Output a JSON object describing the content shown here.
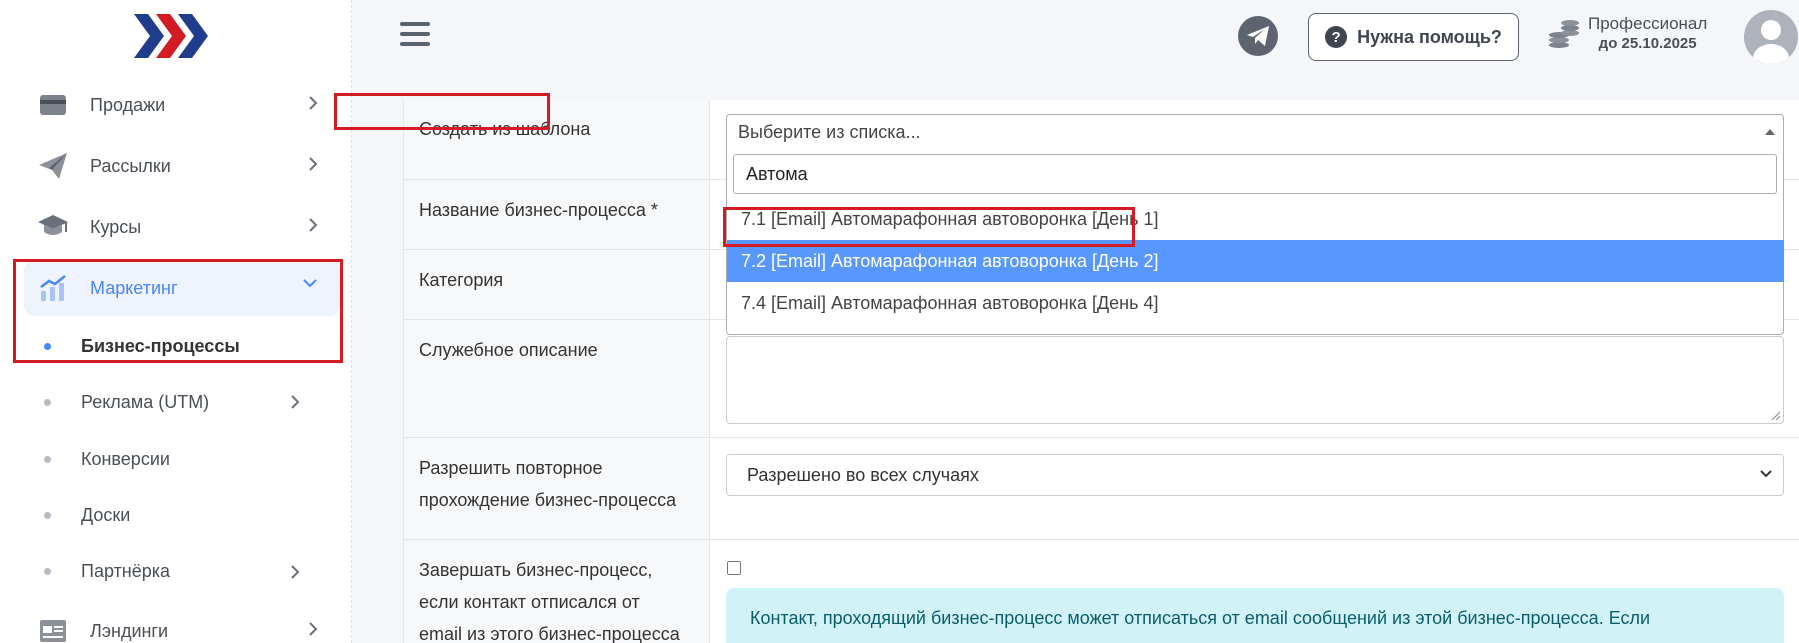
{
  "sidebar": {
    "items": [
      {
        "label": "Продажи",
        "icon": "card-icon"
      },
      {
        "label": "Рассылки",
        "icon": "paper-plane-icon"
      },
      {
        "label": "Курсы",
        "icon": "graduation-cap-icon"
      },
      {
        "label": "Маркетинг",
        "icon": "chart-up-icon"
      }
    ],
    "subitems": [
      {
        "label": "Бизнес-процессы"
      },
      {
        "label": "Реклама (UTM)"
      },
      {
        "label": "Конверсии"
      },
      {
        "label": "Доски"
      },
      {
        "label": "Партнёрка"
      }
    ],
    "bottom_item": {
      "label": "Лэндинги",
      "icon": "landing-page-icon"
    }
  },
  "header": {
    "help_label": "Нужна помощь?",
    "plan_name": "Профессионал",
    "plan_until": "до 25.10.2025"
  },
  "form": {
    "template_label": "Создать из шаблона",
    "template_placeholder": "Выберите из списка...",
    "search_value": "Автома",
    "options": [
      "7.1 [Email] Автомарафонная автоворонка [День 1]",
      "7.2 [Email] Автомарафонная автоворонка [День 2]",
      "7.4 [Email] Автомарафонная автоворонка [День 4]"
    ],
    "selected_option_index": 1,
    "name_label": "Название бизнес-процесса *",
    "category_label": "Категория",
    "description_label": "Служебное описание",
    "repeat_label_line1": "Разрешить повторное",
    "repeat_label_line2": "прохождение бизнес-процесса",
    "repeat_value": "Разрешено во всех случаях",
    "finish_label_line1": "Завершать бизнес-процесс,",
    "finish_label_line2": "если контакт отписался от",
    "finish_label_line3": "email из этого бизнес-процесса",
    "alert_text": "Контакт, проходящий бизнес-процесс может отписаться от email сообщений из этой бизнес-процесса. Если"
  },
  "colors": {
    "accent": "#4a86f7",
    "highlight_box": "#d31b23",
    "selected_option": "#5897fb",
    "alert_bg": "#d1f3f7"
  }
}
